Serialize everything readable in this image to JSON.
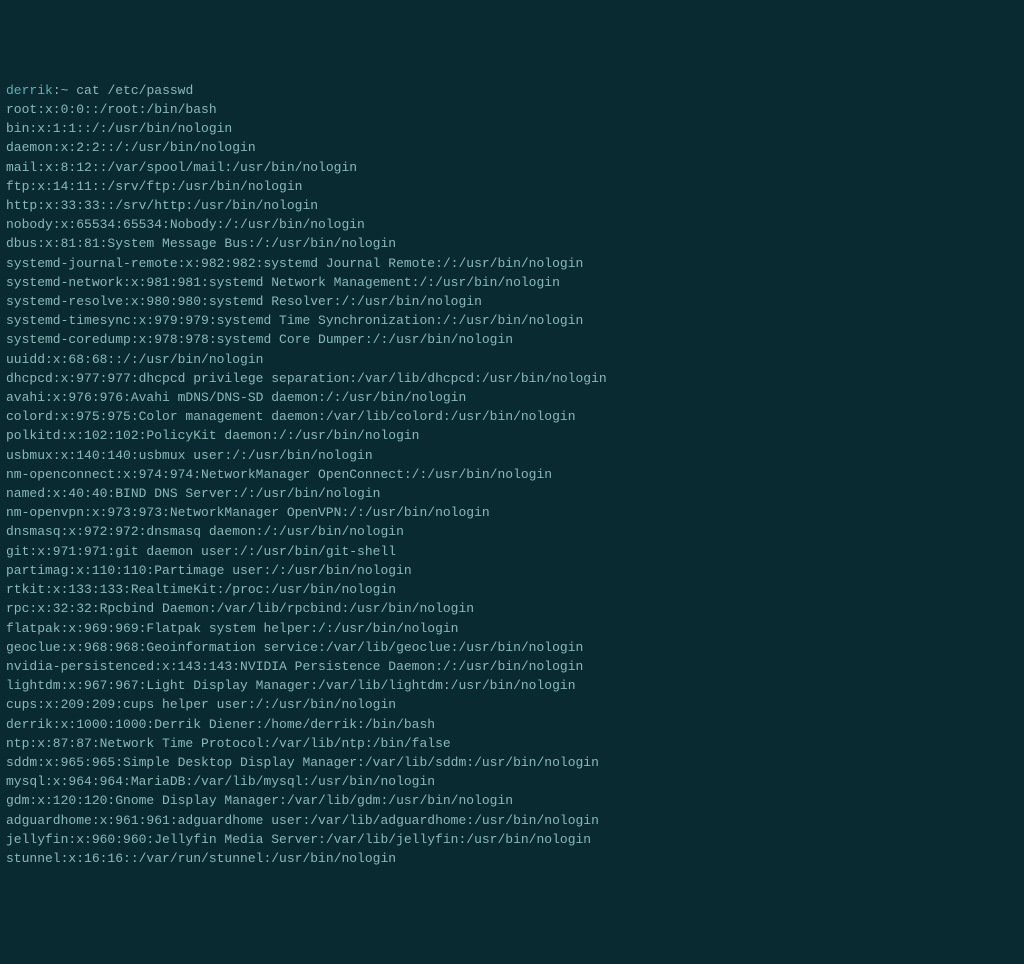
{
  "prompt": {
    "user": "derrik",
    "separator": ":",
    "path": "~",
    "symbol": " "
  },
  "command": "cat /etc/passwd",
  "output": [
    "root:x:0:0::/root:/bin/bash",
    "bin:x:1:1::/:/usr/bin/nologin",
    "daemon:x:2:2::/:/usr/bin/nologin",
    "mail:x:8:12::/var/spool/mail:/usr/bin/nologin",
    "ftp:x:14:11::/srv/ftp:/usr/bin/nologin",
    "http:x:33:33::/srv/http:/usr/bin/nologin",
    "nobody:x:65534:65534:Nobody:/:/usr/bin/nologin",
    "dbus:x:81:81:System Message Bus:/:/usr/bin/nologin",
    "systemd-journal-remote:x:982:982:systemd Journal Remote:/:/usr/bin/nologin",
    "systemd-network:x:981:981:systemd Network Management:/:/usr/bin/nologin",
    "systemd-resolve:x:980:980:systemd Resolver:/:/usr/bin/nologin",
    "systemd-timesync:x:979:979:systemd Time Synchronization:/:/usr/bin/nologin",
    "systemd-coredump:x:978:978:systemd Core Dumper:/:/usr/bin/nologin",
    "uuidd:x:68:68::/:/usr/bin/nologin",
    "dhcpcd:x:977:977:dhcpcd privilege separation:/var/lib/dhcpcd:/usr/bin/nologin",
    "avahi:x:976:976:Avahi mDNS/DNS-SD daemon:/:/usr/bin/nologin",
    "colord:x:975:975:Color management daemon:/var/lib/colord:/usr/bin/nologin",
    "polkitd:x:102:102:PolicyKit daemon:/:/usr/bin/nologin",
    "usbmux:x:140:140:usbmux user:/:/usr/bin/nologin",
    "nm-openconnect:x:974:974:NetworkManager OpenConnect:/:/usr/bin/nologin",
    "named:x:40:40:BIND DNS Server:/:/usr/bin/nologin",
    "nm-openvpn:x:973:973:NetworkManager OpenVPN:/:/usr/bin/nologin",
    "dnsmasq:x:972:972:dnsmasq daemon:/:/usr/bin/nologin",
    "git:x:971:971:git daemon user:/:/usr/bin/git-shell",
    "partimag:x:110:110:Partimage user:/:/usr/bin/nologin",
    "rtkit:x:133:133:RealtimeKit:/proc:/usr/bin/nologin",
    "rpc:x:32:32:Rpcbind Daemon:/var/lib/rpcbind:/usr/bin/nologin",
    "flatpak:x:969:969:Flatpak system helper:/:/usr/bin/nologin",
    "geoclue:x:968:968:Geoinformation service:/var/lib/geoclue:/usr/bin/nologin",
    "nvidia-persistenced:x:143:143:NVIDIA Persistence Daemon:/:/usr/bin/nologin",
    "lightdm:x:967:967:Light Display Manager:/var/lib/lightdm:/usr/bin/nologin",
    "cups:x:209:209:cups helper user:/:/usr/bin/nologin",
    "derrik:x:1000:1000:Derrik Diener:/home/derrik:/bin/bash",
    "ntp:x:87:87:Network Time Protocol:/var/lib/ntp:/bin/false",
    "sddm:x:965:965:Simple Desktop Display Manager:/var/lib/sddm:/usr/bin/nologin",
    "mysql:x:964:964:MariaDB:/var/lib/mysql:/usr/bin/nologin",
    "gdm:x:120:120:Gnome Display Manager:/var/lib/gdm:/usr/bin/nologin",
    "adguardhome:x:961:961:adguardhome user:/var/lib/adguardhome:/usr/bin/nologin",
    "jellyfin:x:960:960:Jellyfin Media Server:/var/lib/jellyfin:/usr/bin/nologin",
    "stunnel:x:16:16::/var/run/stunnel:/usr/bin/nologin"
  ]
}
